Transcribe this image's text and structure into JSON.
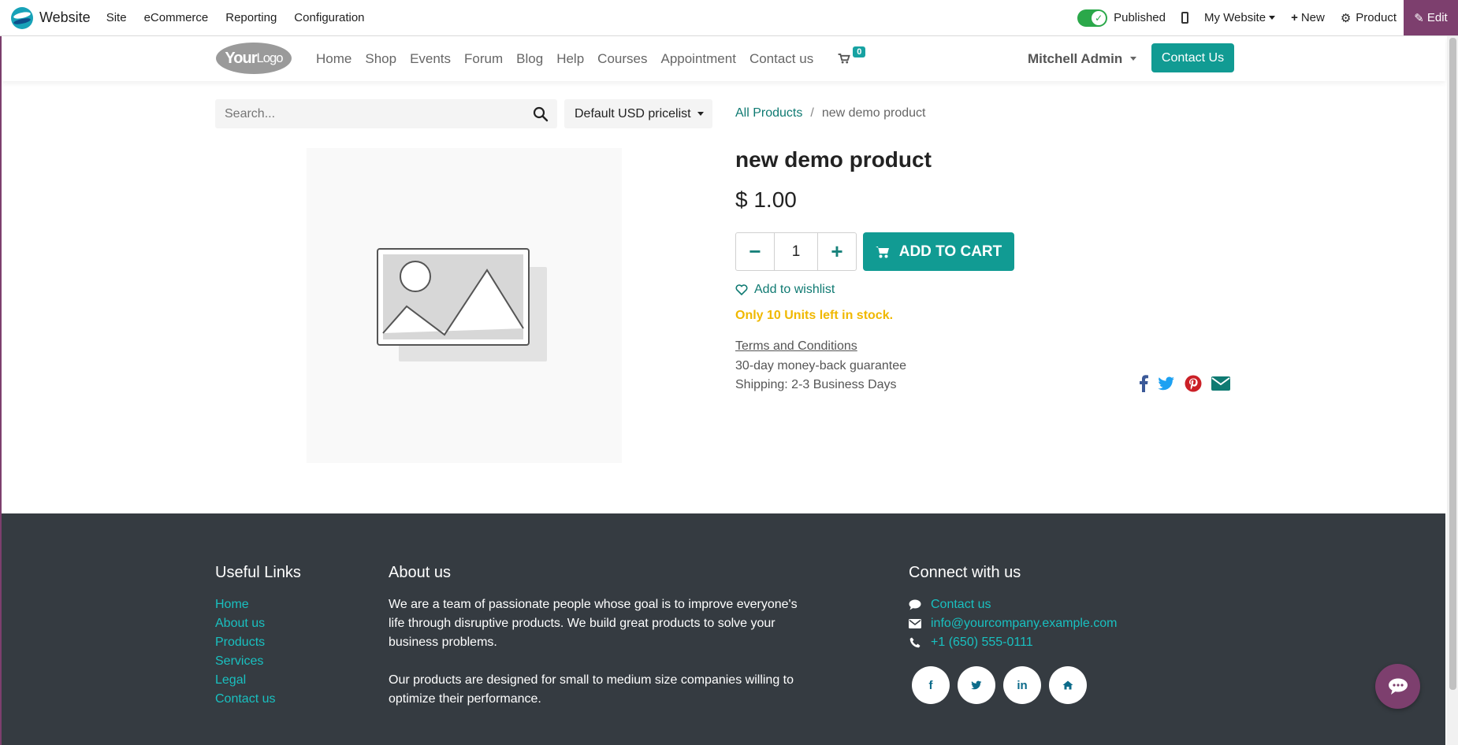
{
  "adminbar": {
    "brand": "Website",
    "menu": [
      "Site",
      "eCommerce",
      "Reporting",
      "Configuration"
    ],
    "published_label": "Published",
    "website_label": "My Website",
    "new_label": "New",
    "product_label": "Product",
    "edit_label": "Edit",
    "accent_color": "#7d3f6e"
  },
  "header": {
    "logo_text": "Your",
    "logo_text2": "Logo",
    "nav": [
      "Home",
      "Shop",
      "Events",
      "Forum",
      "Blog",
      "Help",
      "Courses",
      "Appointment",
      "Contact us"
    ],
    "cart_count": "0",
    "user_name": "Mitchell Admin",
    "contact_button": "Contact Us"
  },
  "search": {
    "placeholder": "Search..."
  },
  "pricelist": {
    "label": "Default USD pricelist"
  },
  "breadcrumb": {
    "parent": "All Products",
    "separator": "/",
    "current": "new demo product"
  },
  "product": {
    "title": "new demo product",
    "price": "$ 1.00",
    "quantity": "1",
    "add_to_cart": "ADD TO CART",
    "wishlist": "Add to wishlist",
    "stock": "Only 10 Units left in stock.",
    "terms": "Terms and Conditions",
    "guarantee": "30-day money-back guarantee",
    "shipping": "Shipping: 2-3 Business Days",
    "primary_color": "#119b93",
    "stock_color": "#f0b800"
  },
  "footer": {
    "useful_links_title": "Useful Links",
    "useful_links": [
      "Home",
      "About us",
      "Products",
      "Services",
      "Legal",
      "Contact us"
    ],
    "about_title": "About us",
    "about_p1": "We are a team of passionate people whose goal is to improve everyone's life through disruptive products. We build great products to solve your business problems.",
    "about_p2": "Our products are designed for small to medium size companies willing to optimize their performance.",
    "connect_title": "Connect with us",
    "contact_link": "Contact us",
    "email": "info@yourcompany.example.com",
    "phone": "+1 (650) 555-0111",
    "background": "#353b41",
    "link_color": "#19c0c0"
  }
}
